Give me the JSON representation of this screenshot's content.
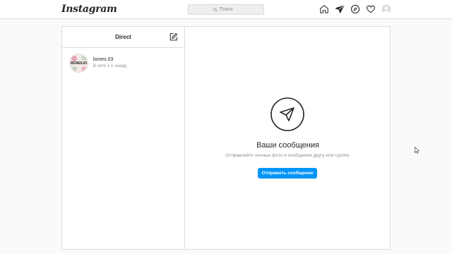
{
  "header": {
    "logo": "Instagram",
    "search_placeholder": "Поиск",
    "nav_icons": [
      "home-icon",
      "direct-icon",
      "explore-icon",
      "activity-icon",
      "profile-avatar"
    ]
  },
  "direct": {
    "title": "Direct",
    "threads": [
      {
        "name": "boxes.03",
        "status": "В сети 1 ч. назад",
        "avatar_text": "BOXES.03"
      }
    ]
  },
  "empty_state": {
    "title": "Ваши сообщения",
    "subtitle": "Отправляйте личные фото и сообщения другу или группе.",
    "button_label": "Отправить сообщение"
  },
  "colors": {
    "accent": "#0095f6",
    "border": "#dbdbdb",
    "background": "#fafafa",
    "muted_text": "#8e8e8e"
  }
}
